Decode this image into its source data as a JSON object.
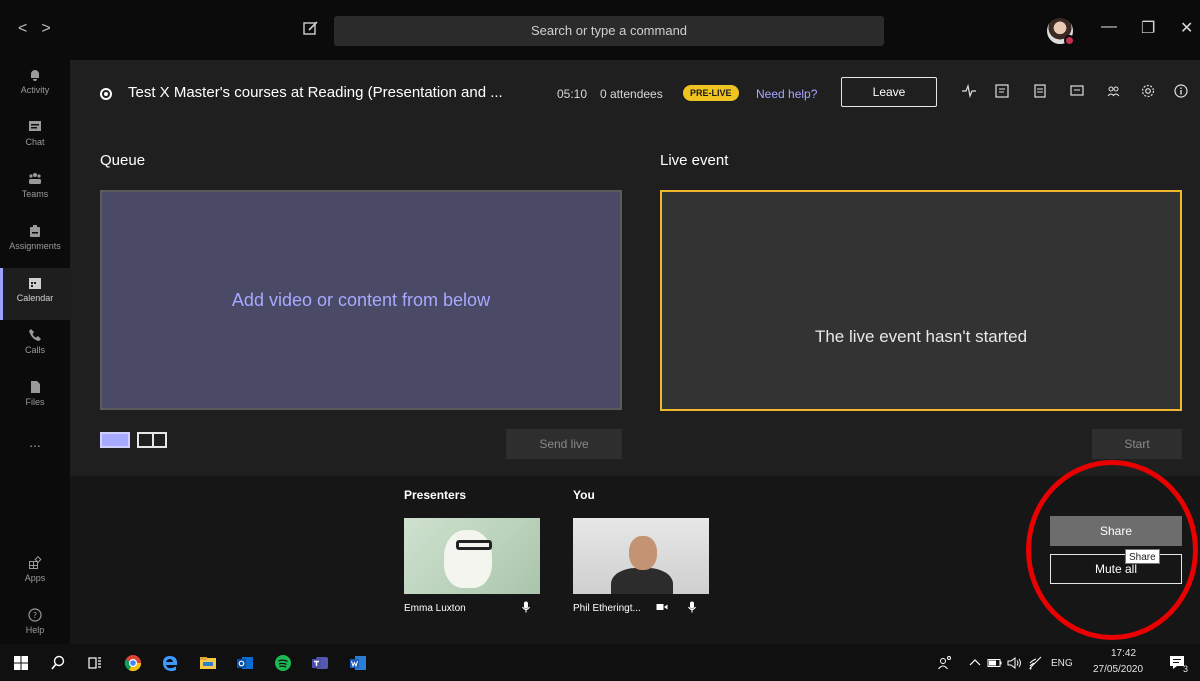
{
  "titlebar": {
    "search_placeholder": "Search or type a command",
    "nav_back": "<",
    "nav_forward": ">"
  },
  "rail": {
    "items": [
      {
        "label": "Activity",
        "icon": "bell-icon"
      },
      {
        "label": "Chat",
        "icon": "chat-icon"
      },
      {
        "label": "Teams",
        "icon": "teams-icon"
      },
      {
        "label": "Assignments",
        "icon": "assignments-icon"
      },
      {
        "label": "Calendar",
        "icon": "calendar-icon"
      },
      {
        "label": "Calls",
        "icon": "phone-icon"
      },
      {
        "label": "Files",
        "icon": "file-icon"
      }
    ],
    "more": "...",
    "apps": "Apps",
    "help": "Help"
  },
  "event": {
    "title": "Test X Master's courses at Reading (Presentation and ...",
    "timer": "05:10",
    "attendees": "0 attendees",
    "status_badge": "PRE-LIVE",
    "need_help": "Need help?",
    "leave_label": "Leave"
  },
  "queue": {
    "label": "Queue",
    "placeholder": "Add video or content from below",
    "send_live": "Send live"
  },
  "live": {
    "label": "Live event",
    "status": "The live event hasn't started",
    "start": "Start"
  },
  "presenters": {
    "label": "Presenters",
    "you_label": "You",
    "people": [
      {
        "name": "Emma Luxton"
      },
      {
        "name": "Phil Etheringt..."
      }
    ]
  },
  "actions": {
    "share": "Share",
    "mute_all": "Mute all",
    "tooltip": "Share"
  },
  "taskbar": {
    "lang": "ENG",
    "time": "17:42",
    "date": "27/05/2020",
    "notifications": "3"
  },
  "colors": {
    "accent": "#a6a9ff",
    "live_border": "#f0b72f",
    "prelive_badge": "#f0c420",
    "annotation": "#e90000"
  }
}
